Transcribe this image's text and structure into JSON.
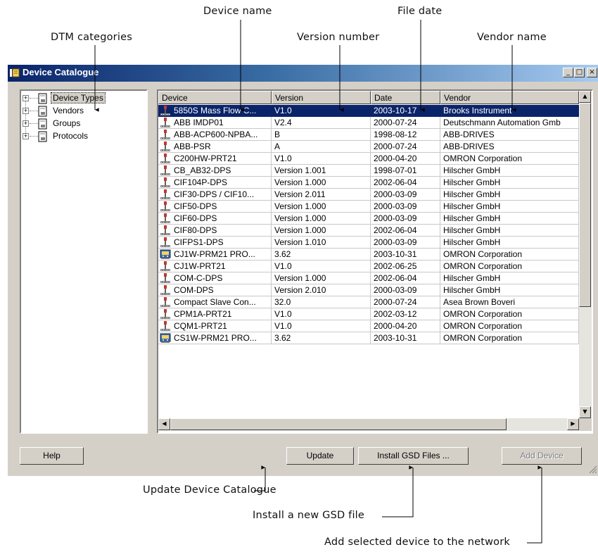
{
  "callouts": {
    "device_name": "Device name",
    "file_date": "File date",
    "dtm_categories": "DTM categories",
    "version_number": "Version number",
    "vendor_name": "Vendor name",
    "update_catalogue": "Update Device Catalogue",
    "install_gsd": "Install a new GSD file",
    "add_device": "Add selected device to the network"
  },
  "window": {
    "title": "Device Catalogue",
    "controls": {
      "minimize": "_",
      "maximize": "□",
      "close": "×"
    }
  },
  "tree": {
    "items": [
      {
        "label": "Device Types",
        "selected": true
      },
      {
        "label": "Vendors"
      },
      {
        "label": "Groups"
      },
      {
        "label": "Protocols"
      }
    ]
  },
  "table": {
    "columns": [
      "Device",
      "Version",
      "Date",
      "Vendor"
    ],
    "rows": [
      {
        "device": "5850S Mass Flow C...",
        "version": "V1.0",
        "date": "2003-10-17",
        "vendor": "Brooks Instrument",
        "icon": "device-icon",
        "selected": true
      },
      {
        "device": "ABB IMDP01",
        "version": "V2.4",
        "date": "2000-07-24",
        "vendor": "Deutschmann Automation Gmb",
        "icon": "device-icon"
      },
      {
        "device": "ABB-ACP600-NPBA...",
        "version": "B",
        "date": "1998-08-12",
        "vendor": "ABB-DRIVES",
        "icon": "device-icon"
      },
      {
        "device": "ABB-PSR",
        "version": "A",
        "date": "2000-07-24",
        "vendor": "ABB-DRIVES",
        "icon": "device-icon"
      },
      {
        "device": "C200HW-PRT21",
        "version": "V1.0",
        "date": "2000-04-20",
        "vendor": "OMRON Corporation",
        "icon": "device-icon"
      },
      {
        "device": "CB_AB32-DPS",
        "version": "Version 1.001",
        "date": "1998-07-01",
        "vendor": "Hilscher GmbH",
        "icon": "device-icon"
      },
      {
        "device": "CIF104P-DPS",
        "version": "Version 1.000",
        "date": "2002-06-04",
        "vendor": "Hilscher GmbH",
        "icon": "device-icon"
      },
      {
        "device": "CIF30-DPS / CIF10...",
        "version": "Version 2.011",
        "date": "2000-03-09",
        "vendor": "Hilscher GmbH",
        "icon": "device-icon"
      },
      {
        "device": "CIF50-DPS",
        "version": "Version 1.000",
        "date": "2000-03-09",
        "vendor": "Hilscher GmbH",
        "icon": "device-icon"
      },
      {
        "device": "CIF60-DPS",
        "version": "Version 1.000",
        "date": "2000-03-09",
        "vendor": "Hilscher GmbH",
        "icon": "device-icon"
      },
      {
        "device": "CIF80-DPS",
        "version": "Version 1.000",
        "date": "2002-06-04",
        "vendor": "Hilscher GmbH",
        "icon": "device-icon"
      },
      {
        "device": "CIFPS1-DPS",
        "version": "Version 1.010",
        "date": "2000-03-09",
        "vendor": "Hilscher GmbH",
        "icon": "device-icon"
      },
      {
        "device": "CJ1W-PRM21 PRO...",
        "version": "3.62",
        "date": "2003-10-31",
        "vendor": "OMRON Corporation",
        "icon": "dtm-device-icon"
      },
      {
        "device": "CJ1W-PRT21",
        "version": "V1.0",
        "date": "2002-06-25",
        "vendor": "OMRON Corporation",
        "icon": "device-icon"
      },
      {
        "device": "COM-C-DPS",
        "version": "Version 1.000",
        "date": "2002-06-04",
        "vendor": "Hilscher GmbH",
        "icon": "device-icon"
      },
      {
        "device": "COM-DPS",
        "version": "Version 2.010",
        "date": "2000-03-09",
        "vendor": "Hilscher GmbH",
        "icon": "device-icon"
      },
      {
        "device": "Compact Slave Con...",
        "version": "32.0",
        "date": "2000-07-24",
        "vendor": "Asea Brown Boveri",
        "icon": "device-icon"
      },
      {
        "device": "CPM1A-PRT21",
        "version": "V1.0",
        "date": "2002-03-12",
        "vendor": "OMRON Corporation",
        "icon": "device-icon"
      },
      {
        "device": "CQM1-PRT21",
        "version": "V1.0",
        "date": "2000-04-20",
        "vendor": "OMRON Corporation",
        "icon": "device-icon"
      },
      {
        "device": "CS1W-PRM21 PRO...",
        "version": "3.62",
        "date": "2003-10-31",
        "vendor": "OMRON Corporation",
        "icon": "dtm-device-icon"
      }
    ]
  },
  "buttons": {
    "help": "Help",
    "update": "Update",
    "install_gsd": "Install GSD Files ...",
    "add_device": "Add Device"
  }
}
